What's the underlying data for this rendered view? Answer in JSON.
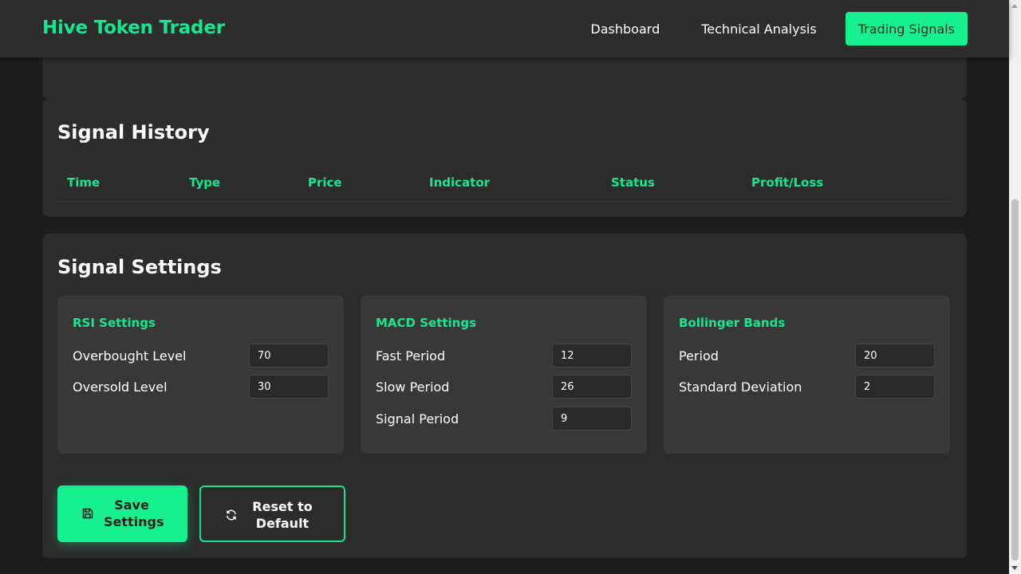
{
  "header": {
    "brand": "Hive Token Trader",
    "nav": [
      "Dashboard",
      "Technical Analysis",
      "Trading Signals"
    ],
    "active_nav": "Trading Signals"
  },
  "history": {
    "title": "Signal History",
    "columns": [
      "Time",
      "Type",
      "Price",
      "Indicator",
      "Status",
      "Profit/Loss"
    ]
  },
  "settings": {
    "title": "Signal Settings",
    "rsi": {
      "title": "RSI Settings",
      "overbought_label": "Overbought Level",
      "overbought_value": "70",
      "oversold_label": "Oversold Level",
      "oversold_value": "30"
    },
    "macd": {
      "title": "MACD Settings",
      "fast_label": "Fast Period",
      "fast_value": "12",
      "slow_label": "Slow Period",
      "slow_value": "26",
      "signal_label": "Signal Period",
      "signal_value": "9"
    },
    "bollinger": {
      "title": "Bollinger Bands",
      "period_label": "Period",
      "period_value": "20",
      "std_label": "Standard Deviation",
      "std_value": "2"
    },
    "save_label": "Save Settings",
    "reset_label": "Reset to Default"
  },
  "icons": {
    "save": "floppy-disk-icon",
    "reset": "refresh-icon"
  },
  "colors": {
    "accent": "#17f08f",
    "background": "#1c1c1c",
    "card": "#2c2c2c",
    "panel": "#383838"
  }
}
